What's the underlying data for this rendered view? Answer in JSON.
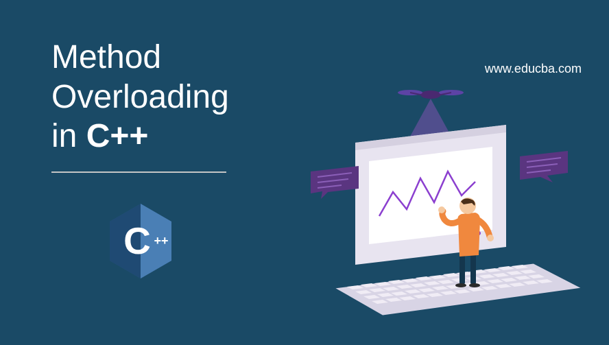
{
  "title": {
    "line1": "Method",
    "line2": "Overloading",
    "line3_prefix": "in ",
    "line3_bold": "C++"
  },
  "logo": {
    "name": "cpp-logo",
    "letter": "C",
    "suffix": "++"
  },
  "website": "www.educba.com",
  "colors": {
    "background": "#1a4a66",
    "text": "#ffffff",
    "logo_blue": "#2b5f8e",
    "logo_light": "#5a8dbf",
    "accent_purple": "#8b3fcf",
    "accent_magenta": "#b855d8",
    "person_orange": "#f0883e",
    "person_skin": "#f5c9a0",
    "screen_white": "#f0ecf5"
  }
}
